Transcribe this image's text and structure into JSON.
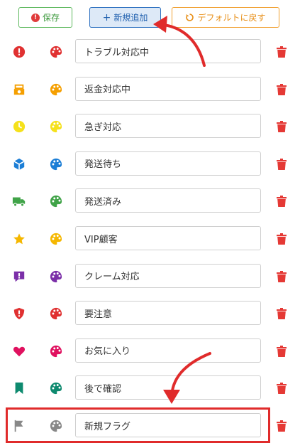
{
  "toolbar": {
    "save_label": "保存",
    "add_label": "新規追加",
    "reset_label": "デフォルトに戻す"
  },
  "tags": [
    {
      "label": "トラブル対応中",
      "icon": "exclamation-circle-icon",
      "color": "#e03131"
    },
    {
      "label": "返金対応中",
      "icon": "refund-icon",
      "color": "#f59f00"
    },
    {
      "label": "急ぎ対応",
      "icon": "clock-icon",
      "color": "#f5e11b"
    },
    {
      "label": "発送待ち",
      "icon": "box-icon",
      "color": "#1c7ed6"
    },
    {
      "label": "発送済み",
      "icon": "truck-icon",
      "color": "#40a348"
    },
    {
      "label": "VIP顧客",
      "icon": "star-icon",
      "color": "#f5b700"
    },
    {
      "label": "クレーム対応",
      "icon": "comment-exclamation-icon",
      "color": "#7b2fa8"
    },
    {
      "label": "要注意",
      "icon": "shield-exclamation-icon",
      "color": "#e03131"
    },
    {
      "label": "お気に入り",
      "icon": "heart-icon",
      "color": "#e0115f"
    },
    {
      "label": "後で確認",
      "icon": "bookmark-icon",
      "color": "#0e8a6f"
    },
    {
      "label": "新規フラグ",
      "icon": "flag-icon",
      "color": "#888888"
    }
  ],
  "delete_color": "#e53935"
}
